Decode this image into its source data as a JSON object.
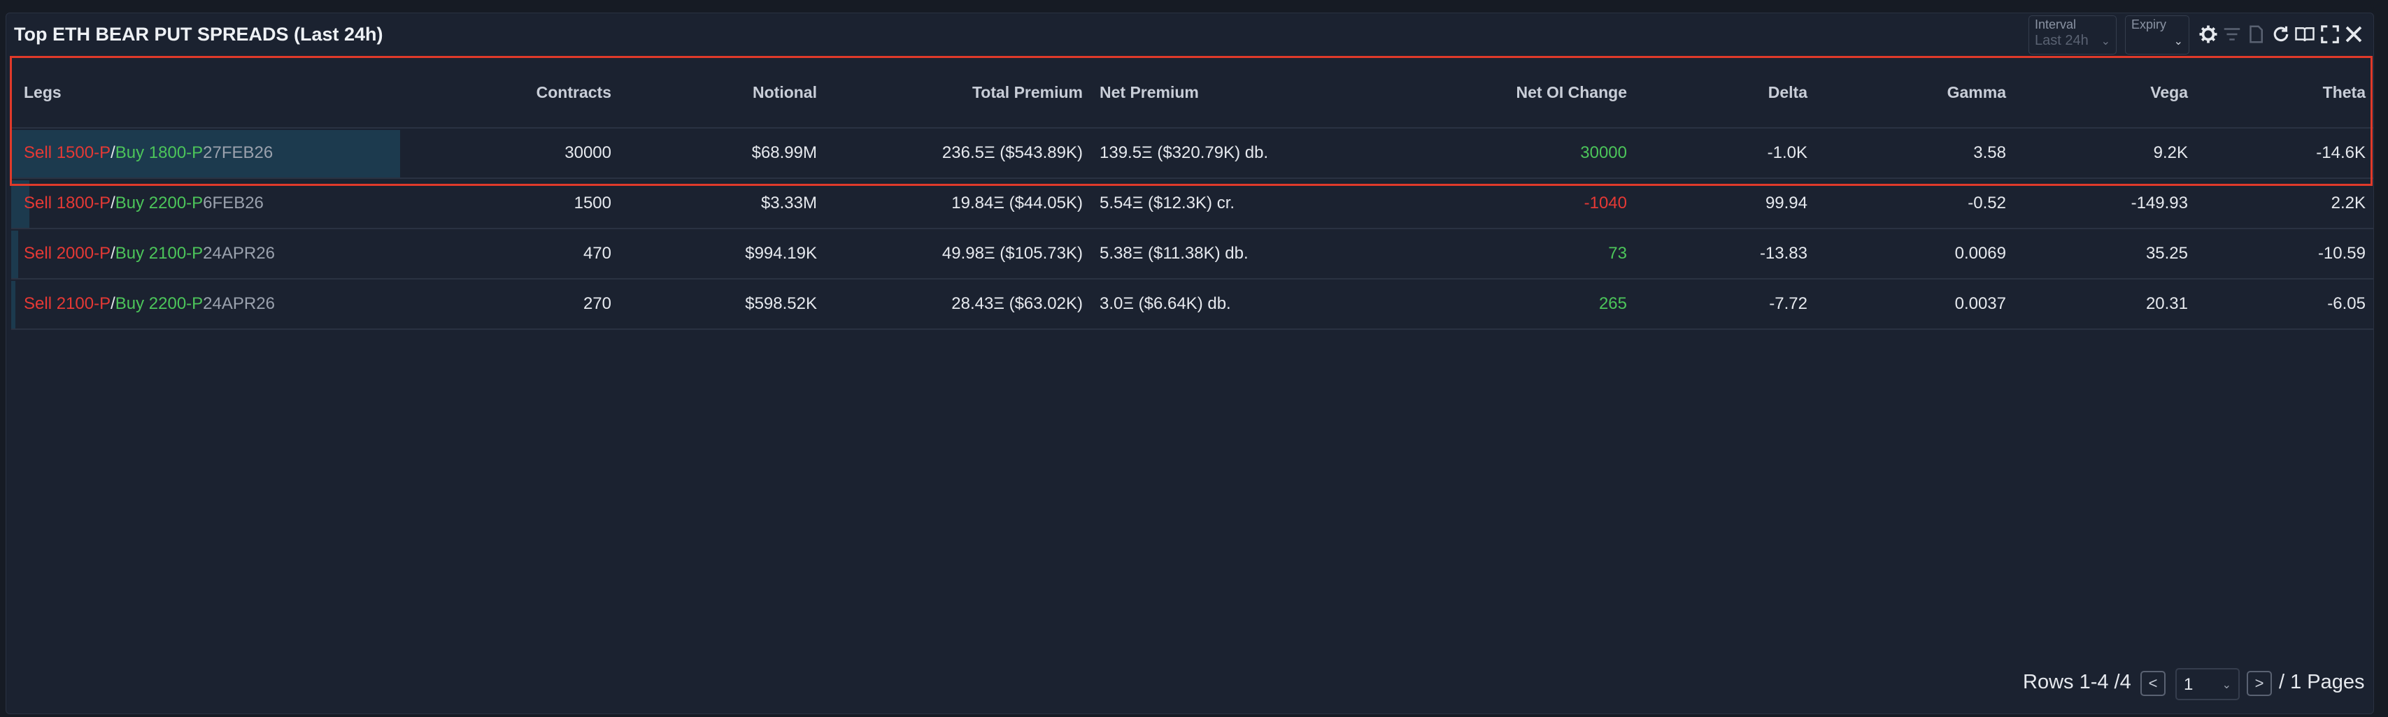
{
  "panel": {
    "title": "Top ETH BEAR PUT SPREADS (Last 24h)",
    "interval": {
      "label": "Interval",
      "value": "Last 24h"
    },
    "expiry": {
      "label": "Expiry",
      "value": ""
    },
    "tools": [
      "settings-icon",
      "filter-icon",
      "document-icon",
      "refresh-icon",
      "book-icon",
      "expand-icon",
      "close-icon"
    ]
  },
  "table": {
    "headers": {
      "legs": "Legs",
      "contracts": "Contracts",
      "notional": "Notional",
      "total_premium": "Total Premium",
      "net_premium": "Net Premium",
      "net_oi_change": "Net OI Change",
      "delta": "Delta",
      "gamma": "Gamma",
      "vega": "Vega",
      "theta": "Theta"
    },
    "rows": [
      {
        "sell": "Sell 1500-P",
        "sep": " / ",
        "buy": "Buy 1800-P",
        "expiry": " 27FEB26",
        "contracts": "30000",
        "notional": "$68.99M",
        "total_premium": "236.5Ξ ($543.89K)",
        "net_premium": "139.5Ξ ($320.79K) db.",
        "net_oi_change": "30000",
        "delta": "-1.0K",
        "gamma": "3.58",
        "vega": "9.2K",
        "theta": "-14.6K"
      },
      {
        "sell": "Sell 1800-P",
        "sep": " / ",
        "buy": "Buy 2200-P",
        "expiry": " 6FEB26",
        "contracts": "1500",
        "notional": "$3.33M",
        "total_premium": "19.84Ξ ($44.05K)",
        "net_premium": "5.54Ξ ($12.3K) cr.",
        "net_oi_change": "-1040",
        "delta": "99.94",
        "gamma": "-0.52",
        "vega": "-149.93",
        "theta": "2.2K"
      },
      {
        "sell": "Sell 2000-P",
        "sep": " / ",
        "buy": "Buy 2100-P",
        "expiry": " 24APR26",
        "contracts": "470",
        "notional": "$994.19K",
        "total_premium": "49.98Ξ ($105.73K)",
        "net_premium": "5.38Ξ ($11.38K) db.",
        "net_oi_change": "73",
        "delta": "-13.83",
        "gamma": "0.0069",
        "vega": "35.25",
        "theta": "-10.59"
      },
      {
        "sell": "Sell 2100-P",
        "sep": " / ",
        "buy": "Buy 2200-P",
        "expiry": " 24APR26",
        "contracts": "270",
        "notional": "$598.52K",
        "total_premium": "28.43Ξ ($63.02K)",
        "net_premium": "3.0Ξ ($6.64K) db.",
        "net_oi_change": "265",
        "delta": "-7.72",
        "gamma": "0.0037",
        "vega": "20.31",
        "theta": "-6.05"
      }
    ]
  },
  "pagination": {
    "rows_text": "Rows 1-4 /4",
    "prev": "<",
    "page": "1",
    "next": ">",
    "pages_text": "/ 1 Pages"
  },
  "colors": {
    "sell": "#e53935",
    "buy": "#4cc55a",
    "highlight": "#e03a2a",
    "background": "#1b2230"
  }
}
